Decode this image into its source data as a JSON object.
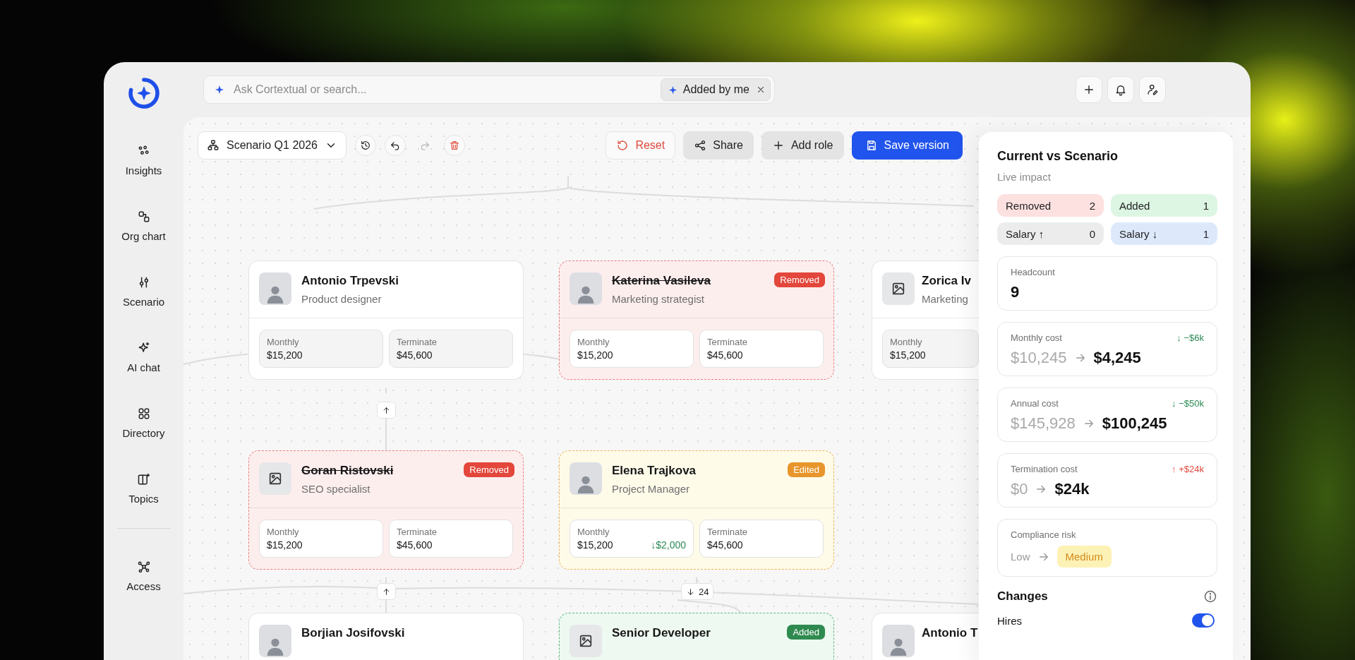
{
  "sidebar": {
    "groups": [
      [
        {
          "label": "Insights"
        },
        {
          "label": "Org chart"
        },
        {
          "label": "Scenario"
        },
        {
          "label": "AI chat"
        },
        {
          "label": "Directory"
        },
        {
          "label": "Topics"
        }
      ],
      [
        {
          "label": "Access"
        }
      ]
    ]
  },
  "search": {
    "placeholder": "Ask Cortextual or search...",
    "chip": "Added by me"
  },
  "toolbar": {
    "scenario": "Scenario Q1 2026",
    "tools": [
      {
        "kind": "history",
        "disabled": false
      },
      {
        "kind": "undo",
        "disabled": false
      },
      {
        "kind": "redo",
        "disabled": true
      },
      {
        "kind": "delete",
        "disabled": false
      }
    ],
    "actions": [
      {
        "label": "Reset",
        "kind": "reset"
      },
      {
        "label": "Share",
        "kind": "share"
      },
      {
        "label": "Add role",
        "kind": "add"
      },
      {
        "label": "Save version",
        "kind": "save"
      }
    ]
  },
  "cards": [
    {
      "name": "Antonio Trpevski",
      "role": "Product designer",
      "kind": "plain",
      "photo": true,
      "stats": [
        {
          "label": "Monthly",
          "value": "$15,200"
        },
        {
          "label": "Terminate",
          "value": "$45,600"
        }
      ]
    },
    {
      "name": "Katerina Vasileva",
      "role": "Marketing strategist",
      "kind": "removed",
      "badge": "Removed",
      "photo": true,
      "stats": [
        {
          "label": "Monthly",
          "value": "$15,200"
        },
        {
          "label": "Terminate",
          "value": "$45,600"
        }
      ]
    },
    {
      "name": "Zorica Iv",
      "role": "Marketing",
      "kind": "plain",
      "photo": false,
      "stats": [
        {
          "label": "Monthly",
          "value": "$15,200"
        }
      ]
    },
    {
      "name": "Goran Ristovski",
      "role": "SEO specialist",
      "kind": "removed",
      "badge": "Removed",
      "photo": false,
      "stats": [
        {
          "label": "Monthly",
          "value": "$15,200"
        },
        {
          "label": "Terminate",
          "value": "$45,600"
        }
      ]
    },
    {
      "name": "Elena Trajkova",
      "role": "Project Manager",
      "kind": "edited",
      "badge": "Edited",
      "photo": true,
      "stats": [
        {
          "label": "Monthly",
          "value": "$15,200",
          "delta": "↓$2,000"
        },
        {
          "label": "Terminate",
          "value": "$45,600"
        }
      ]
    },
    {
      "name": "Borjian Josifovski",
      "kind": "plain",
      "photo": true
    },
    {
      "name": "Senior Developer",
      "kind": "added",
      "badge": "Added",
      "photo": false
    },
    {
      "name": "Antonio T",
      "kind": "plain",
      "photo": true
    }
  ],
  "expanders": [
    {
      "kind": "up"
    },
    {
      "kind": "up"
    },
    {
      "kind": "down",
      "count": "24"
    }
  ],
  "panel": {
    "title": "Current vs Scenario",
    "subtitle": "Live impact",
    "counters": [
      {
        "label": "Removed",
        "count": "2",
        "kind": "removed"
      },
      {
        "label": "Added",
        "count": "1",
        "kind": "added"
      },
      {
        "label": "Salary ↑",
        "count": "0",
        "kind": "up"
      },
      {
        "label": "Salary ↓",
        "count": "1",
        "kind": "down"
      }
    ],
    "metrics": [
      {
        "kind": "single",
        "label": "Headcount",
        "value": "9"
      },
      {
        "kind": "change",
        "label": "Monthly cost",
        "from": "$10,245",
        "to": "$4,245",
        "delta": "↓ −$6k",
        "good": true
      },
      {
        "kind": "change",
        "label": "Annual cost",
        "from": "$145,928",
        "to": "$100,245",
        "delta": "↓ −$50k",
        "good": true
      },
      {
        "kind": "change",
        "label": "Termination cost",
        "from": "$0",
        "to": "$24k",
        "delta": "↑ +$24k",
        "good": false
      },
      {
        "kind": "risk",
        "label": "Compliance risk",
        "from": "Low",
        "to": "Medium"
      }
    ],
    "changes_title": "Changes",
    "changes": [
      {
        "label": "Hires",
        "on": true
      }
    ]
  }
}
